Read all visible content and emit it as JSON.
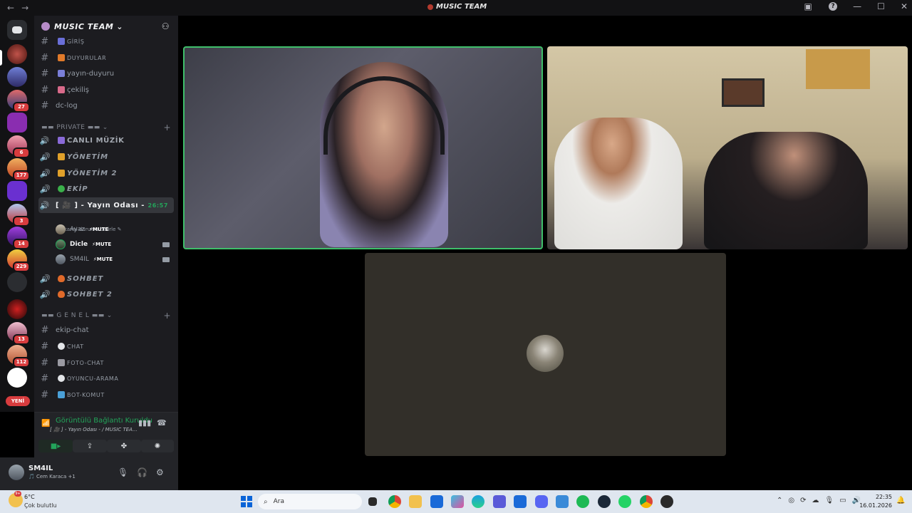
{
  "window": {
    "title": "MUSIC TEAM",
    "nav_back": "←",
    "nav_forward": "→",
    "controls": [
      "—",
      "☐",
      "✕"
    ],
    "help": "?"
  },
  "server": {
    "name": "MUSIC TEAM",
    "chevron": "⌄"
  },
  "guild_badges": [
    "27",
    "6",
    "177",
    "3",
    "14",
    "229",
    "13",
    "112"
  ],
  "guild_new": "YENİ",
  "channels": {
    "giris": "GİRİŞ",
    "duyurular": "DUYURULAR",
    "yayin_duyuru": "yayın-duyuru",
    "cekilis": "çekiliş",
    "dc_log": "dc-log",
    "private_category": "▬▬ PRIVATE ▬▬",
    "canli_muzik": "CANLI MÜZİK",
    "yonetim": "YÖNETİM",
    "yonetim2": "YÖNETİM 2",
    "ekip": "EKİP",
    "yayin_odasi": "[ 🎥 ] - Yayın Odası -",
    "yayin_timer": "26:57",
    "yayin_status": "Bir kanal durumu belirle",
    "sohbet": "SOHBET",
    "sohbet2": "SOHBET 2",
    "genel_category": "▬▬ G E N E L ▬▬",
    "ekip_chat": "ekip-chat",
    "chat": "CHAT",
    "foto_chat": "FOTO-CHAT",
    "oyuncu_arama": "OYUNCU-ARAMA",
    "bot_komut": "BOT-KOMUT"
  },
  "voice_users": [
    {
      "name": "Ayaz",
      "tag": "⚡MUTE"
    },
    {
      "name": "Dicle",
      "tag": "⚡MUTE"
    },
    {
      "name": "SM4IL",
      "tag": "⚡MUTE"
    }
  ],
  "voice_panel": {
    "status": "Görüntülü Bağlantı Kuruldu",
    "subtitle": "[ 🎥 ] - Yayın Odası - / MUSIC TEA..."
  },
  "user": {
    "name": "SM4IL",
    "activity": "🎵 Cem Karaca +1"
  },
  "taskbar": {
    "weather_badge": "9+",
    "temperature": "6°C",
    "condition": "Çok bulutlu",
    "search_placeholder": "Ara",
    "time": "22:35",
    "date": "16.01.2026"
  },
  "colors": {
    "accent_green": "#23a55a",
    "speaking_border": "#3fbf6a",
    "badge_red": "#d83c3e",
    "sidebar_bg": "#1c1c20",
    "guild_bg": "#121214"
  },
  "icons": [
    "discord-logo-icon",
    "search-icon",
    "invite-icon",
    "hash-icon",
    "speaker-icon",
    "camera-icon",
    "screen-share-icon",
    "activity-icon",
    "soundboard-icon",
    "mic-icon",
    "headphones-icon",
    "settings-icon",
    "disconnect-icon",
    "noise-icon",
    "signal-icon"
  ]
}
